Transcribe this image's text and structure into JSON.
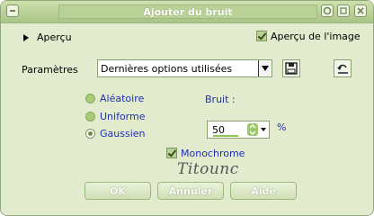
{
  "window": {
    "title": "Ajouter du bruit"
  },
  "preview": {
    "label": "Aperçu",
    "image_preview_label": "Aperçu de l'image"
  },
  "settings": {
    "label": "Paramètres",
    "preset_value": "Dernières options utilisées"
  },
  "noise_type": {
    "options": [
      "Aléatoire",
      "Uniforme",
      "Gaussien"
    ],
    "selected": "Gaussien"
  },
  "noise": {
    "label": "Bruit :",
    "value": "50",
    "unit": "%"
  },
  "monochrome": {
    "label": "Monochrome",
    "checked": true
  },
  "watermark": {
    "text": "Titounc"
  },
  "buttons": {
    "ok": "OK",
    "cancel": "Annuler",
    "help": "Aide"
  }
}
